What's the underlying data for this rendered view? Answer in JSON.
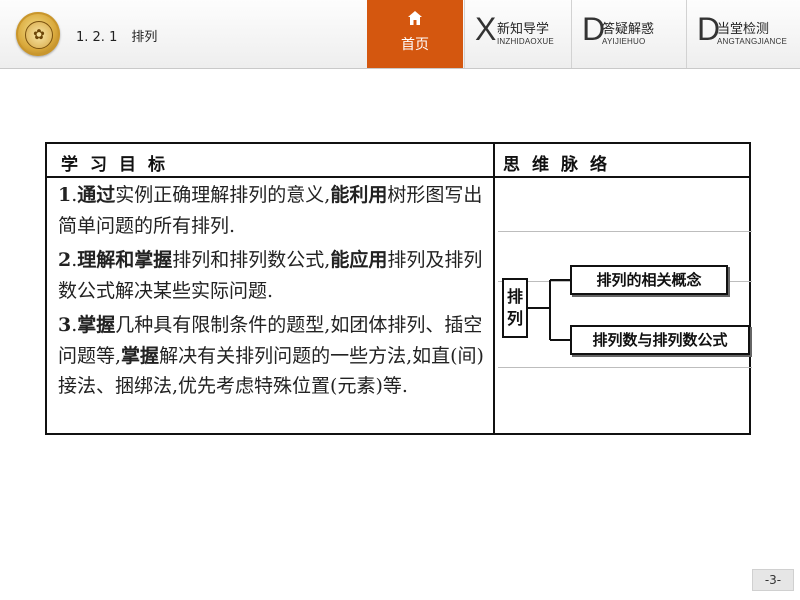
{
  "header": {
    "breadcrumb": {
      "section": "1. 2. 1",
      "title": "排列"
    },
    "home_label": "首页",
    "tabs": [
      {
        "letter": "X",
        "label": "新知导学",
        "pinyin": "INZHIDAOXUE"
      },
      {
        "letter": "D",
        "label": "答疑解惑",
        "pinyin": "AYIJIEHUO"
      },
      {
        "letter": "D",
        "label": "当堂检测",
        "pinyin": "ANGTANGJIANCE"
      }
    ]
  },
  "table": {
    "col1_header": "学习目标",
    "col2_header": "思维脉络",
    "goals": [
      {
        "num": "1",
        "parts": [
          {
            "text": "通过",
            "bold": true
          },
          {
            "text": "实例正确理解排列的意义,",
            "bold": false
          },
          {
            "text": "能利用",
            "bold": true
          },
          {
            "text": "树形图写出简单问题的所有排列.",
            "bold": false
          }
        ]
      },
      {
        "num": "2",
        "parts": [
          {
            "text": "理解和掌握",
            "bold": true
          },
          {
            "text": "排列和排列数公式,",
            "bold": false
          },
          {
            "text": "能应用",
            "bold": true
          },
          {
            "text": "排列及排列数公式解决某些实际问题.",
            "bold": false
          }
        ]
      },
      {
        "num": "3",
        "parts": [
          {
            "text": "掌握",
            "bold": true
          },
          {
            "text": "几种具有限制条件的题型,如团体排列、插空问题等,",
            "bold": false
          },
          {
            "text": "掌握",
            "bold": true
          },
          {
            "text": "解决有关排列问题的一些方法,如直(间)接法、捆绑法,优先考虑特殊位置(元素)等.",
            "bold": false
          }
        ]
      }
    ],
    "diagram": {
      "root": "排列",
      "branches": [
        "排列的相关概念",
        "排列数与排列数公式"
      ]
    }
  },
  "page_number": "-3-"
}
